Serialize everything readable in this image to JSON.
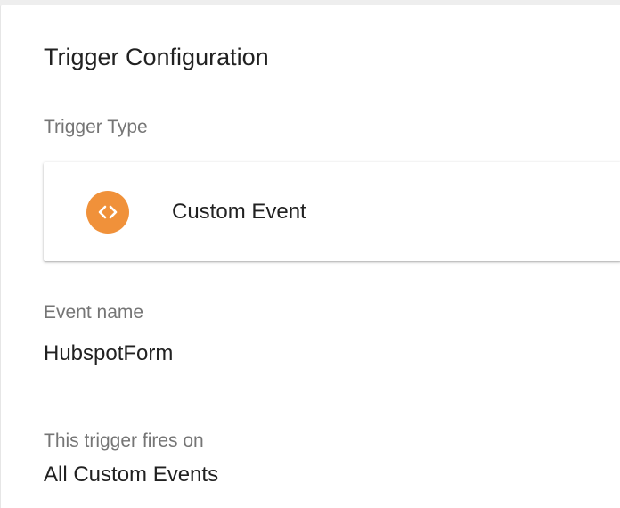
{
  "trigger_config": {
    "title": "Trigger Configuration",
    "trigger_type": {
      "label": "Trigger Type",
      "name": "Custom Event",
      "icon": "code-brackets-icon",
      "icon_color": "#F0913A"
    },
    "event_name": {
      "label": "Event name",
      "value": "HubspotForm"
    },
    "fires_on": {
      "label": "This trigger fires on",
      "value": "All Custom Events"
    }
  }
}
